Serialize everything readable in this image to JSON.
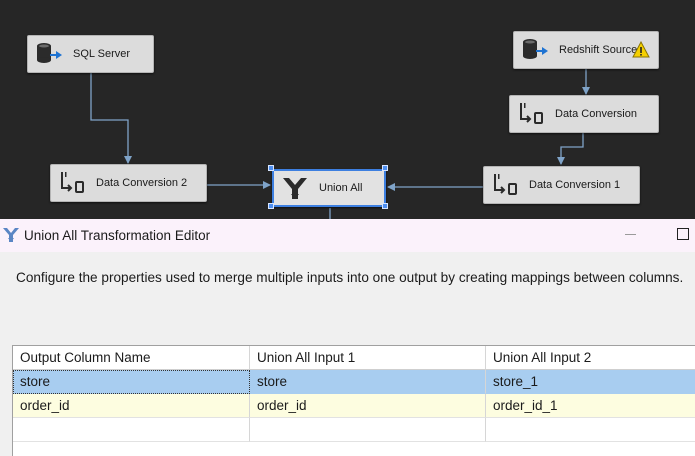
{
  "canvas": {
    "nodes": [
      {
        "id": "sql-server",
        "label": "SQL Server",
        "icon": "database-source-icon"
      },
      {
        "id": "redshift-source",
        "label": "Redshift Source",
        "icon": "database-source-icon",
        "status": "warning-icon"
      },
      {
        "id": "data-conversion",
        "label": "Data Conversion",
        "icon": "data-conversion-icon"
      },
      {
        "id": "data-conversion-2",
        "label": "Data Conversion 2",
        "icon": "data-conversion-icon"
      },
      {
        "id": "union-all",
        "label": "Union All",
        "icon": "union-all-icon",
        "selected": true
      },
      {
        "id": "data-conversion-1",
        "label": "Data Conversion 1",
        "icon": "data-conversion-icon"
      }
    ],
    "colors": {
      "background": "#262626",
      "node": "#dcdcdc",
      "connector": "#7fa3c8",
      "selection": "#3d7fe0",
      "warning": "#f5d000"
    }
  },
  "editor": {
    "title": "Union All Transformation Editor",
    "description": "Configure the properties used to merge multiple inputs into one output by creating mappings between columns.",
    "grid": {
      "columns": [
        "Output Column Name",
        "Union All Input 1",
        "Union All Input 2"
      ],
      "rows": [
        [
          "store",
          "store",
          "store_1"
        ],
        [
          "order_id",
          "order_id",
          "order_id_1"
        ],
        [
          "",
          "",
          ""
        ]
      ],
      "selected_row": 0
    }
  }
}
